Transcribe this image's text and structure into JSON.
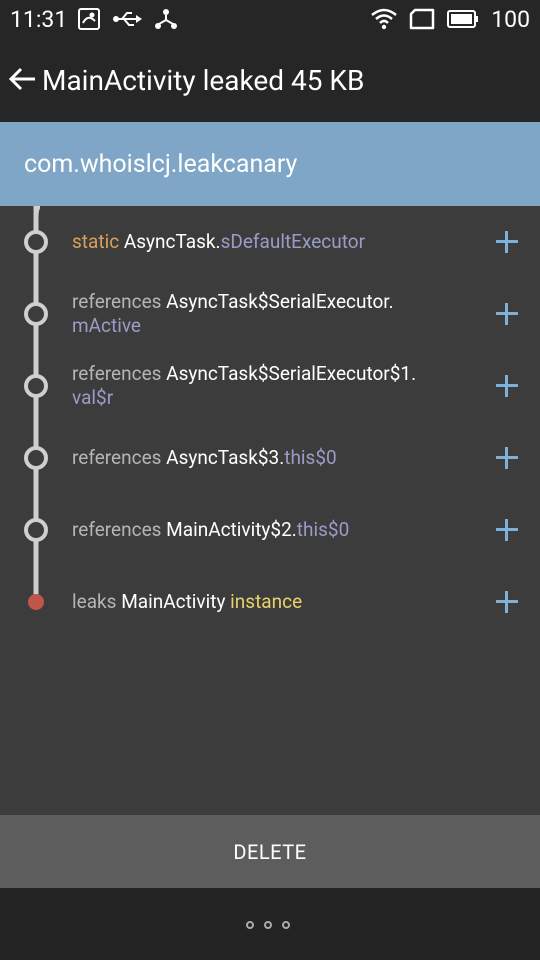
{
  "status_bar": {
    "time": "11:31",
    "battery": "100",
    "left_icons": [
      "gallery-icon",
      "usb-icon",
      "debug-icon"
    ],
    "right_icons": [
      "wifi-icon",
      "sim-icon",
      "battery-icon"
    ]
  },
  "app_bar": {
    "title": "MainActivity leaked 45 KB",
    "back_icon": "arrow-left-icon"
  },
  "package": "com.whoislcj.leakcanary",
  "colors": {
    "header": "#7fa6c6",
    "background": "#3c3c3c",
    "bars": "#262626",
    "timeline": "#cfcfcf",
    "leak_node": "#c0554a",
    "plus": "#7fb0d8",
    "static": "#d8a05a",
    "field": "#9b9cc6",
    "instance": "#e6d26a"
  },
  "trace": [
    {
      "prefix": "static",
      "cls": "AsyncTask.",
      "field": "sDefaultExecutor"
    },
    {
      "prefix": "references",
      "cls": "AsyncTask$SerialExecutor.",
      "field": "mActive"
    },
    {
      "prefix": "references",
      "cls": "AsyncTask$SerialExecutor$1.",
      "field": "val$r"
    },
    {
      "prefix": "references",
      "cls": "AsyncTask$3.",
      "field": "this$0"
    },
    {
      "prefix": "references",
      "cls": "MainActivity$2.",
      "field": "this$0"
    },
    {
      "prefix": "leaks",
      "cls": "MainActivity",
      "field": "instance"
    }
  ],
  "actions": {
    "delete": "DELETE",
    "more_icon": "more-dots-icon"
  }
}
